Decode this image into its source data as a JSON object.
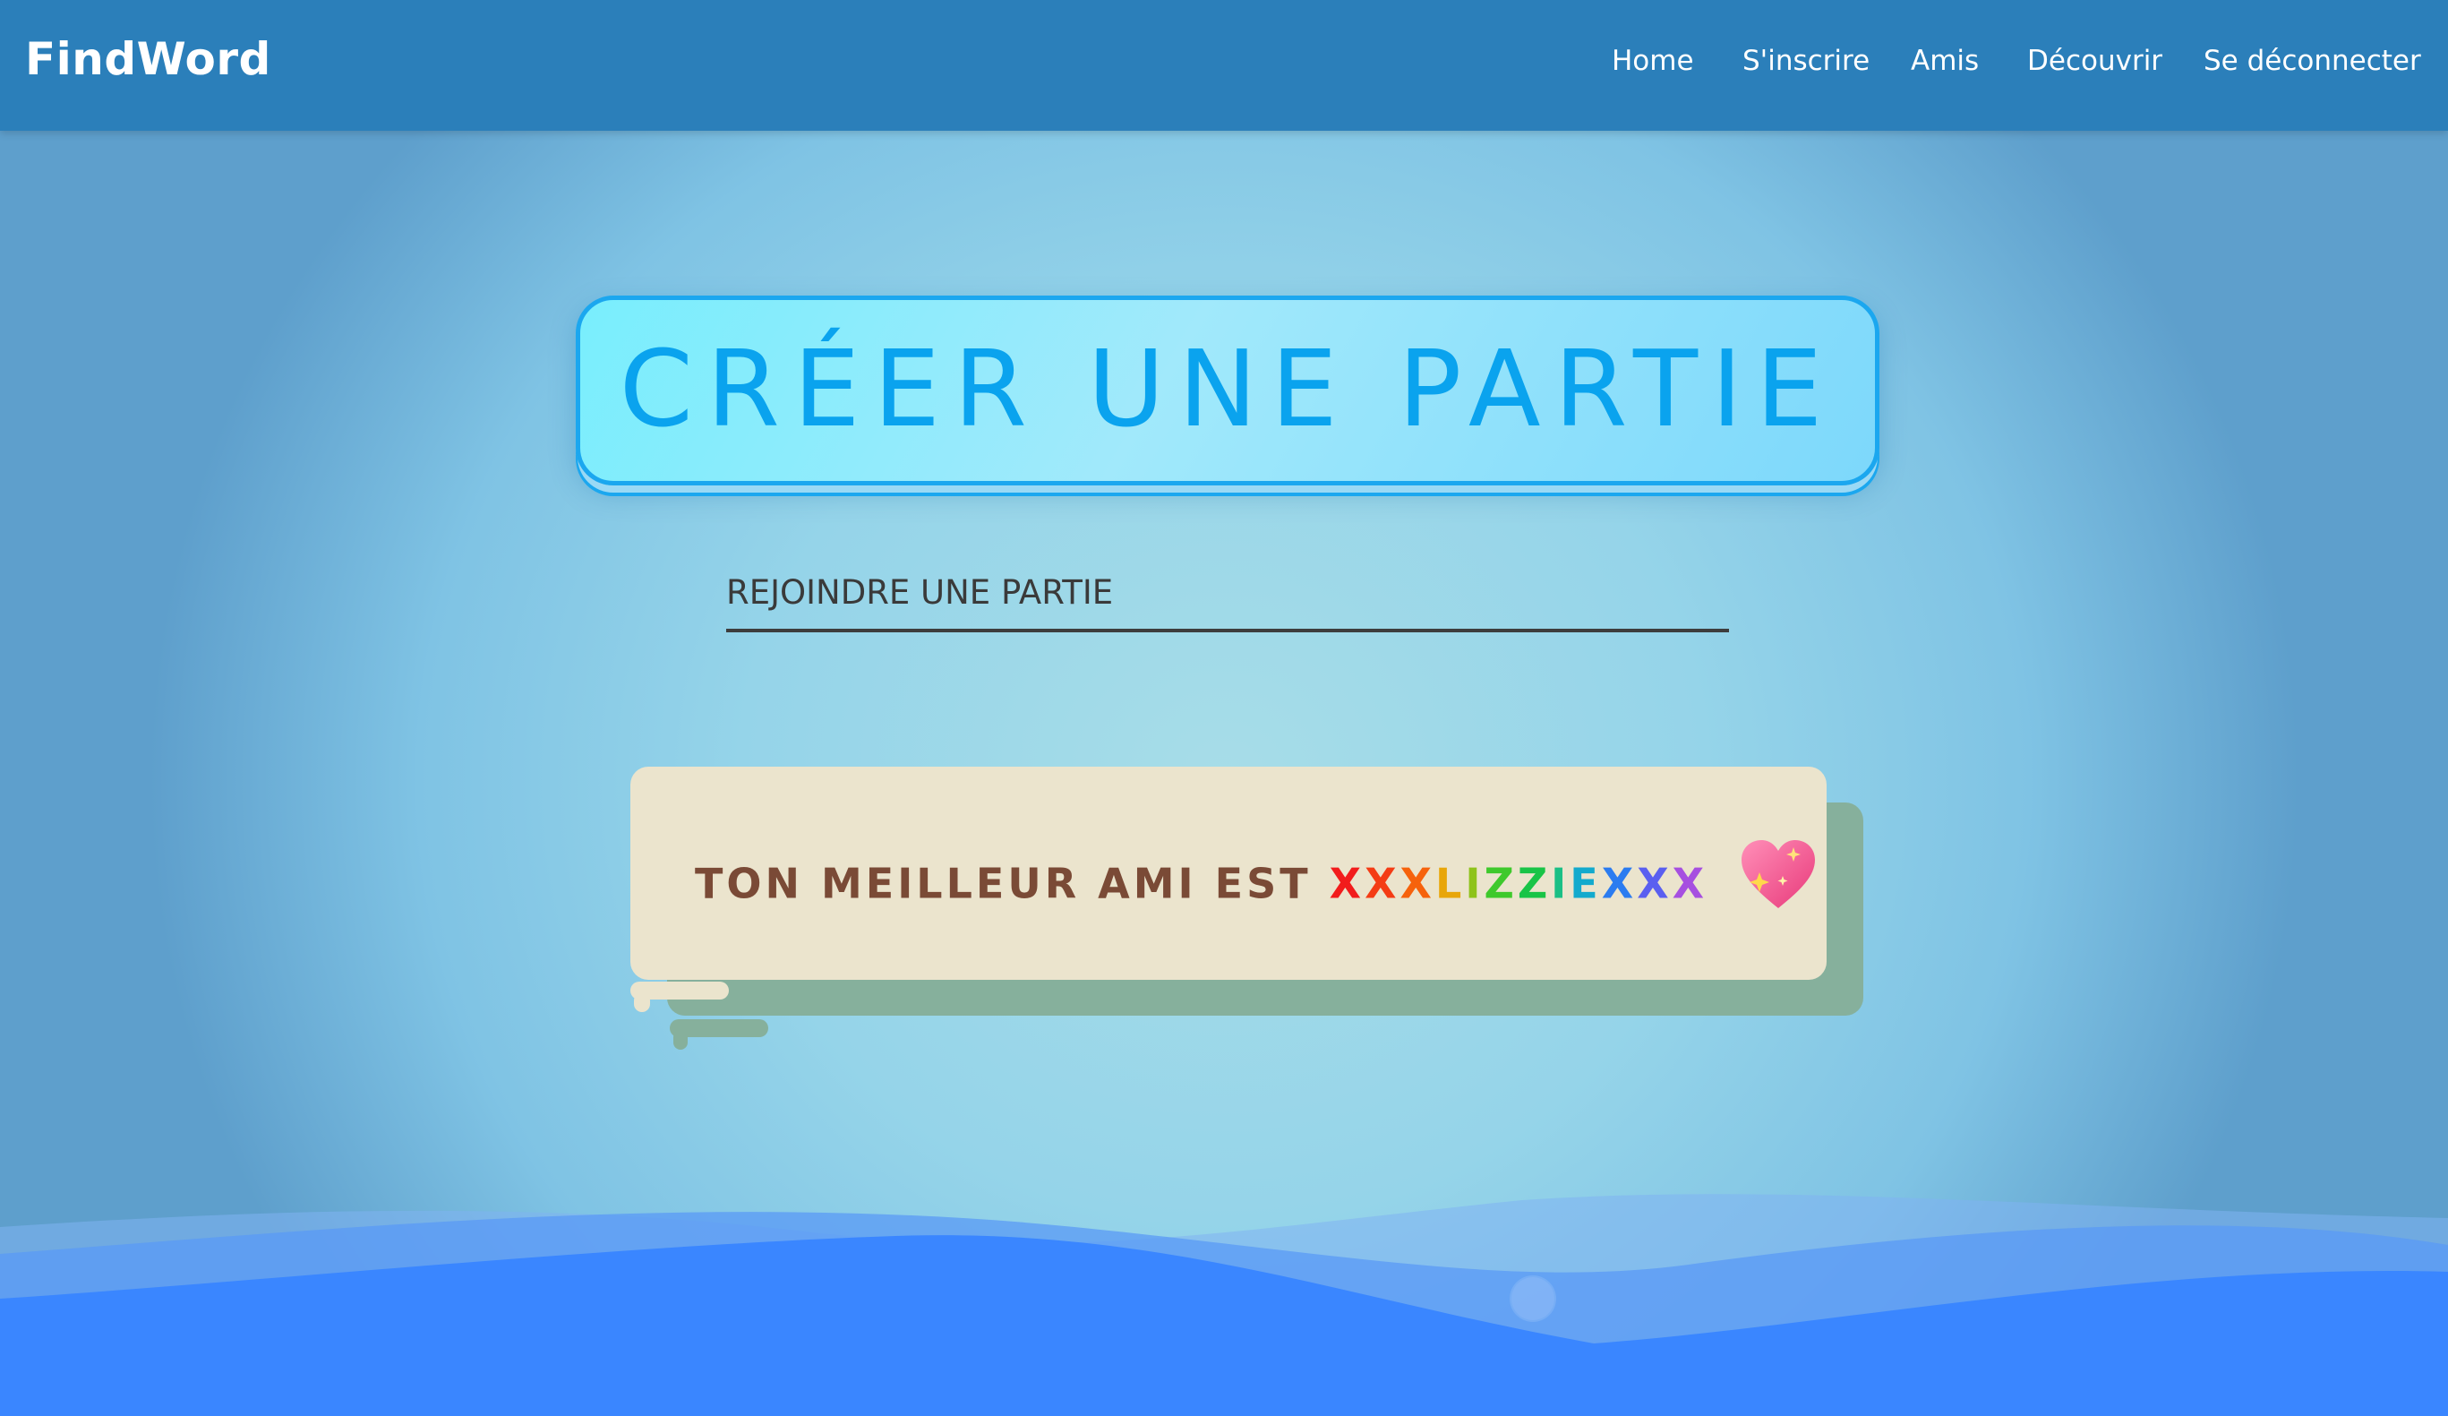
{
  "app": {
    "brand": "FindWord"
  },
  "nav": {
    "items": [
      {
        "label": "Home"
      },
      {
        "label": "S'inscrire"
      },
      {
        "label": "Amis"
      },
      {
        "label": "Découvrir"
      },
      {
        "label": "Se déconnecter"
      }
    ]
  },
  "main": {
    "create_button_label": "CRÉER UNE PARTIE",
    "join_placeholder": "REJOINDRE UNE PARTIE",
    "best_friend": {
      "prefix": "TON MEILLEUR AMI EST",
      "name": "XXXLIZZIEXXX",
      "icon": "sparkling-heart-icon"
    }
  },
  "colors": {
    "navbar": "#2b7fba",
    "create_button_text": "#0aa3ee",
    "create_button_border": "#1ba7ef",
    "card_background": "#ebe4cd",
    "card_shadow": "#86b09c",
    "card_prefix_text": "#7a4a36",
    "wave": "#3a86ff",
    "rainbow": [
      "#f21c1c",
      "#f43c15",
      "#f6620c",
      "#e8a60a",
      "#8ec31a",
      "#3fc92c",
      "#19c447",
      "#1bbf85",
      "#13aacd",
      "#2b7cf0",
      "#5a5ff0",
      "#a64fe0"
    ]
  }
}
